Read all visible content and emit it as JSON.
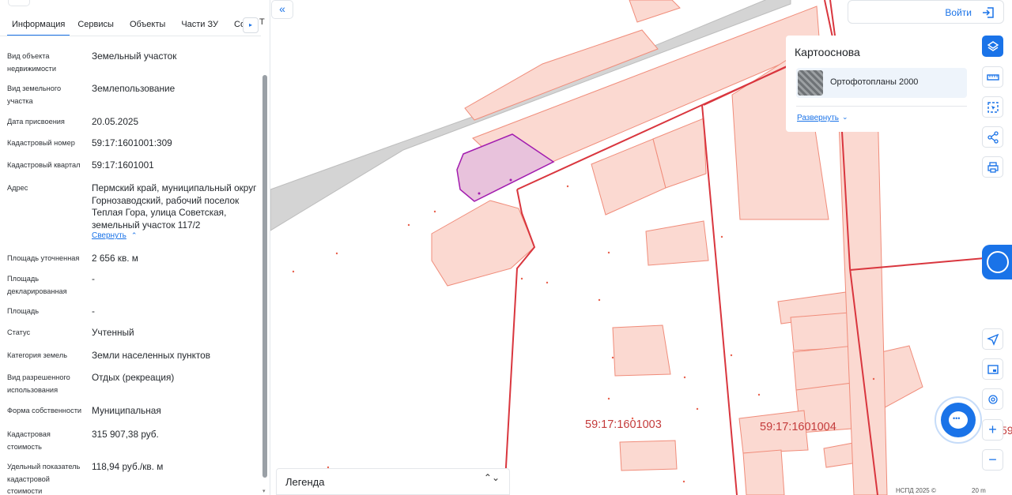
{
  "tabs": [
    "Информация",
    "Сервисы",
    "Объекты",
    "Части ЗУ",
    "Соста"
  ],
  "tab_scroll_label": "▸",
  "tab_overflow_text": "Т",
  "properties": [
    {
      "label": "Вид объекта недвижимости",
      "value": "Земельный участок"
    },
    {
      "label": "Вид земельного участка",
      "value": "Землепользование"
    },
    {
      "label": "Дата присвоения",
      "value": "20.05.2025"
    },
    {
      "label": "Кадастровый номер",
      "value": "59:17:1601001:309"
    },
    {
      "label": "Кадастровый квартал",
      "value": "59:17:1601001"
    },
    {
      "label": "Адрес",
      "value": "Пермский край, муниципальный округ Горнозаводский, рабочий поселок Теплая Гора, улица Советская, земельный участок 117/2"
    },
    {
      "label": "Площадь уточненная",
      "value": "2 656 кв. м"
    },
    {
      "label": "Площадь декларированная",
      "value": "-"
    },
    {
      "label": "Площадь",
      "value": "-"
    },
    {
      "label": "Статус",
      "value": "Учтенный"
    },
    {
      "label": "Категория земель",
      "value": "Земли населенных пунктов"
    },
    {
      "label": "Вид разрешенного использования",
      "value": "Отдых (рекреация)"
    },
    {
      "label": "Форма собственности",
      "value": "Муниципальная"
    },
    {
      "label": "Кадастровая стоимость",
      "value": "315 907,38 руб."
    },
    {
      "label": "Удельный показатель кадастровой стоимости",
      "value": "118,94 руб./кв. м"
    }
  ],
  "address_collapse_link": "Свернуть",
  "collapse_panel_glyph": "«",
  "login_label": "Войти",
  "basemap": {
    "title": "Картооснова",
    "option_label": "Ортофотопланы 2000",
    "expand_link": "Развернуть"
  },
  "map_labels": {
    "quarter_1": "59:17:1601003",
    "quarter_2": "59:17:1601004",
    "partial": "59"
  },
  "legend_label": "Легенда",
  "legend_sort_glyph": "⌃⌄",
  "attribution": "НСПД 2025 ©",
  "scale_label": "20 m",
  "chat_glyph": "•••",
  "zoom_in_glyph": "+",
  "zoom_out_glyph": "−",
  "colors": {
    "accent": "#1a73e8",
    "parcel_fill": "#fbd9d1",
    "parcel_stroke": "#f08c7a",
    "quarter_line": "#d9363e",
    "selected_fill": "#e8c2dc",
    "selected_stroke": "#a21caf",
    "road": "#d4d4d4"
  },
  "icons": [
    "collapse-panel-icon",
    "login-icon",
    "layers-icon",
    "ruler-icon",
    "select-area-icon",
    "share-icon",
    "print-icon",
    "chat-icon",
    "locate-icon",
    "minimap-icon",
    "fingerprint-icon",
    "zoom-in-icon",
    "zoom-out-icon"
  ]
}
